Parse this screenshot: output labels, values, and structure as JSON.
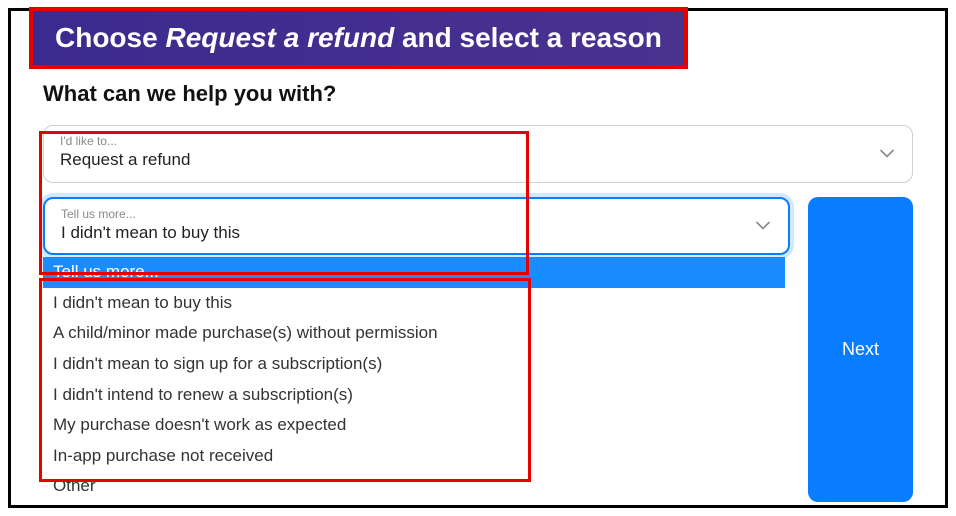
{
  "banner": {
    "prefix": "Choose ",
    "italic": "Request a refund",
    "suffix": " and select a reason"
  },
  "heading": "What can we help you with?",
  "select1": {
    "label": "I'd like to...",
    "value": "Request a refund"
  },
  "select2": {
    "label": "Tell us more...",
    "value": "I didn't mean to buy this"
  },
  "nextButton": "Next",
  "dropdown": {
    "items": [
      "Tell us more...",
      "I didn't mean to buy this",
      "A child/minor made purchase(s) without permission",
      "I didn't mean to sign up for a subscription(s)",
      "I didn't intend to renew a subscription(s)",
      "My purchase doesn't work as expected",
      "In-app purchase not received",
      "Other"
    ],
    "selectedIndex": 0
  },
  "colors": {
    "accent": "#0a7cff",
    "highlight": "#e60000",
    "bannerBg": "#3b2a8f"
  }
}
